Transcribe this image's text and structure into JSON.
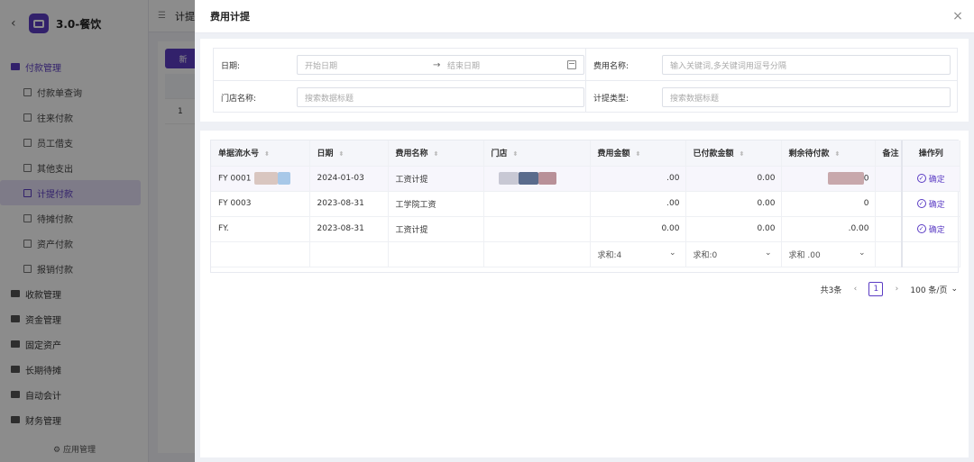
{
  "app": {
    "back_icon": "chevron-left-icon",
    "title": "3.0-餐饮",
    "app_mgmt": "应用管理"
  },
  "sidebar": {
    "groups": [
      {
        "label": "付款管理",
        "active": true,
        "items": [
          {
            "label": "付款单查询"
          },
          {
            "label": "往来付款"
          },
          {
            "label": "员工借支"
          },
          {
            "label": "其他支出"
          },
          {
            "label": "计提付款",
            "active": true
          },
          {
            "label": "待摊付款"
          },
          {
            "label": "资产付款"
          },
          {
            "label": "报销付款"
          }
        ]
      },
      {
        "label": "收款管理"
      },
      {
        "label": "资金管理"
      },
      {
        "label": "固定资产"
      },
      {
        "label": "长期待摊"
      },
      {
        "label": "自动会计"
      },
      {
        "label": "财务管理"
      }
    ]
  },
  "topbar": {
    "crumb": "计提"
  },
  "background": {
    "add_button": "新",
    "row_index": "1"
  },
  "modal": {
    "title": "费用计提",
    "close": "×",
    "filters": {
      "date_label": "日期:",
      "date_start_placeholder": "开始日期",
      "date_end_placeholder": "结束日期",
      "expense_name_label": "费用名称:",
      "expense_name_placeholder": "输入关键词,多关键词用逗号分隔",
      "store_label": "门店名称:",
      "store_placeholder": "搜索数据标题",
      "accrual_type_label": "计提类型:",
      "accrual_type_placeholder": "搜索数据标题"
    },
    "table": {
      "columns": [
        "单据流水号",
        "日期",
        "费用名称",
        "门店",
        "费用金额",
        "已付款金额",
        "剩余待付款",
        "备注",
        "操作列"
      ],
      "rows": [
        {
          "serial": "FY 0001",
          "date": "2024-01-03",
          "expense": "工资计提",
          "store": "",
          "amount": ".00",
          "paid": "0.00",
          "remaining": "0",
          "remark": "",
          "action": "确定"
        },
        {
          "serial": "FY 0003",
          "date": "2023-08-31",
          "expense": "工学院工资",
          "store": "",
          "amount": ".00",
          "paid": "0.00",
          "remaining": "0",
          "remark": "",
          "action": "确定"
        },
        {
          "serial": "FY.",
          "date": "2023-08-31",
          "expense": "工资计提",
          "store": "",
          "amount": "0.00",
          "paid": "0.00",
          "remaining": ".0.00",
          "remark": "",
          "action": "确定"
        }
      ],
      "summary": {
        "amount": "求和:4",
        "paid": "求和:0",
        "remaining": "求和 .00"
      }
    },
    "pagination": {
      "total": "共3条",
      "current_page": "1",
      "page_size": "100 条/页"
    }
  }
}
